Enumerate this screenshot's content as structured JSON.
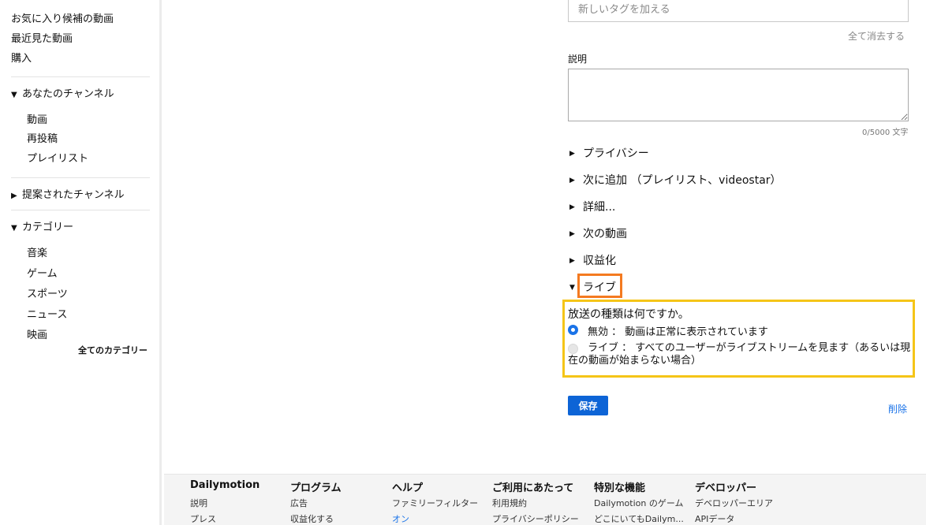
{
  "sidebar": {
    "top_links": [
      "お気に入り候補の動画",
      "最近見た動画",
      "購入"
    ],
    "your_channel": {
      "title": "あなたのチャンネル",
      "items": [
        "動画",
        "再投稿",
        "プレイリスト"
      ]
    },
    "suggested": {
      "title": "提案されたチャンネル"
    },
    "categories": {
      "title": "カテゴリー",
      "items": [
        "音楽",
        "ゲーム",
        "スポーツ",
        "ニュース",
        "映画"
      ],
      "all_label": "全てのカテゴリー"
    }
  },
  "form": {
    "tag_placeholder": "新しいタグを加える",
    "clear_all": "全て消去する",
    "description_label": "説明",
    "description_value": "",
    "char_count": "0/5000 文字",
    "sections": [
      "プライバシー",
      "次に追加 （プレイリスト、videostar）",
      "詳細...",
      "次の動画",
      "収益化",
      "ライブ"
    ],
    "broadcast": {
      "question": "放送の種類は何ですか。",
      "option_disabled": "無効 ： 動画は正常に表示されています",
      "option_live": "ライブ ： すべてのユーザーがライブストリームを見ます（あるいは現在の動画が始まらない場合）",
      "selected": "disabled"
    },
    "save_label": "保存",
    "delete_label": "削除"
  },
  "colors": {
    "accent": "#0d64d6",
    "highlight_live": "#f47a20",
    "highlight_broadcast": "#f5c518"
  },
  "footer": {
    "columns": [
      {
        "title": "Dailymotion",
        "links": [
          "説明",
          "プレス"
        ]
      },
      {
        "title": "プログラム",
        "links": [
          "広告",
          "収益化する"
        ]
      },
      {
        "title": "ヘルプ",
        "links": [
          "ファミリーフィルター",
          "オン"
        ]
      },
      {
        "title": "ご利用にあたって",
        "links": [
          "利用規約",
          "プライバシーポリシー"
        ]
      },
      {
        "title": "特別な機能",
        "links": [
          "Dailymotion のゲーム",
          "どこにいてもDailym..."
        ]
      },
      {
        "title": "デベロッパー",
        "links": [
          "デベロッパーエリア",
          "APIデータ"
        ]
      }
    ]
  }
}
